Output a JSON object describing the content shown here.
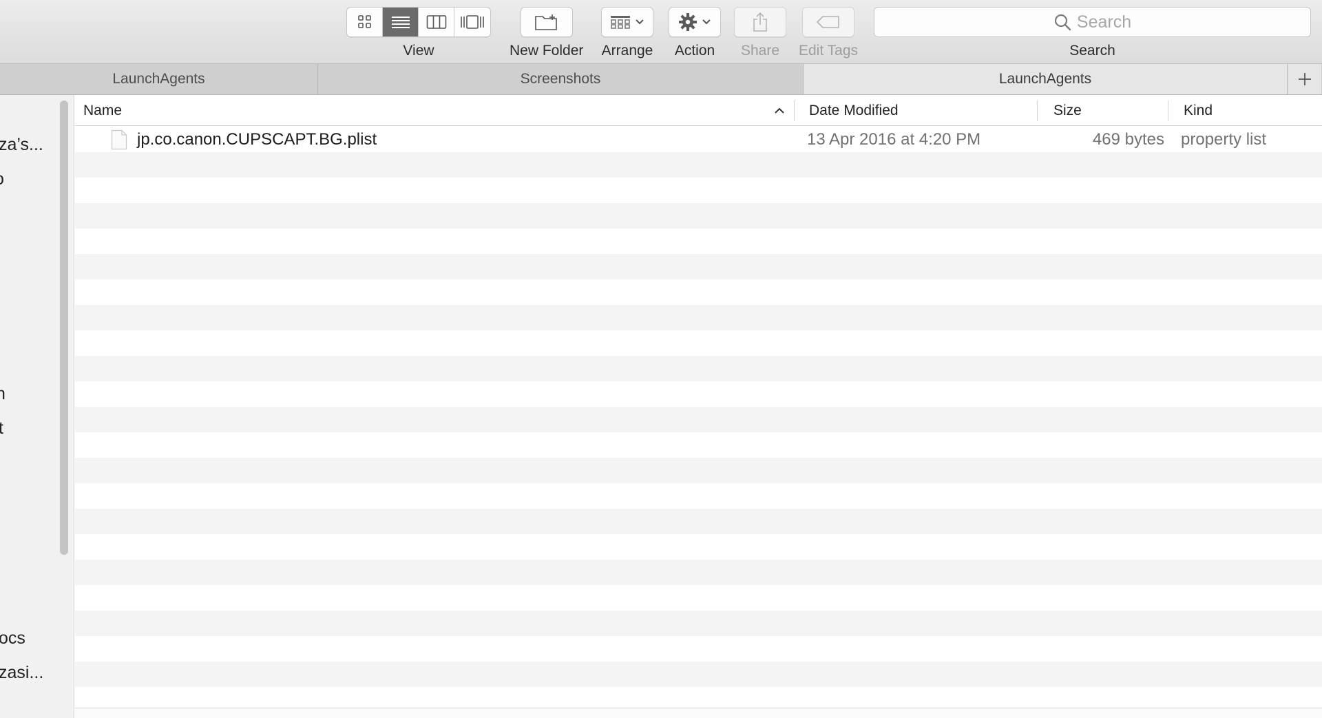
{
  "toolbar": {
    "view_label": "View",
    "new_folder_label": "New Folder",
    "arrange_label": "Arrange",
    "action_label": "Action",
    "share_label": "Share",
    "edit_tags_label": "Edit Tags",
    "search_label": "Search",
    "search_placeholder": "Search",
    "view_modes": [
      {
        "name": "icon-view-icon",
        "active": false
      },
      {
        "name": "list-view-icon",
        "active": true
      },
      {
        "name": "column-view-icon",
        "active": false
      },
      {
        "name": "cover-flow-icon",
        "active": false
      }
    ]
  },
  "tabs": [
    {
      "label": "LaunchAgents",
      "active": false
    },
    {
      "label": "Screenshots",
      "active": false
    },
    {
      "label": "LaunchAgents",
      "active": true
    }
  ],
  "sidebar": {
    "items": [
      {
        "label": "za’s..."
      },
      {
        "label": "o"
      },
      {
        "label": "n"
      },
      {
        "label": "t"
      },
      {
        "label": "ocs"
      },
      {
        "label": "zasi..."
      }
    ]
  },
  "columns": {
    "name": "Name",
    "date_modified": "Date Modified",
    "size": "Size",
    "kind": "Kind"
  },
  "files": [
    {
      "name": "jp.co.canon.CUPSCAPT.BG.plist",
      "date_modified": "13 Apr 2016 at 4:20 PM",
      "size": "469 bytes",
      "kind": "property list"
    }
  ],
  "colors": {
    "toolbar_bg": "#dcdcdc",
    "active_segment": "#6b6b6b",
    "row_stripe": "#f4f4f4"
  }
}
